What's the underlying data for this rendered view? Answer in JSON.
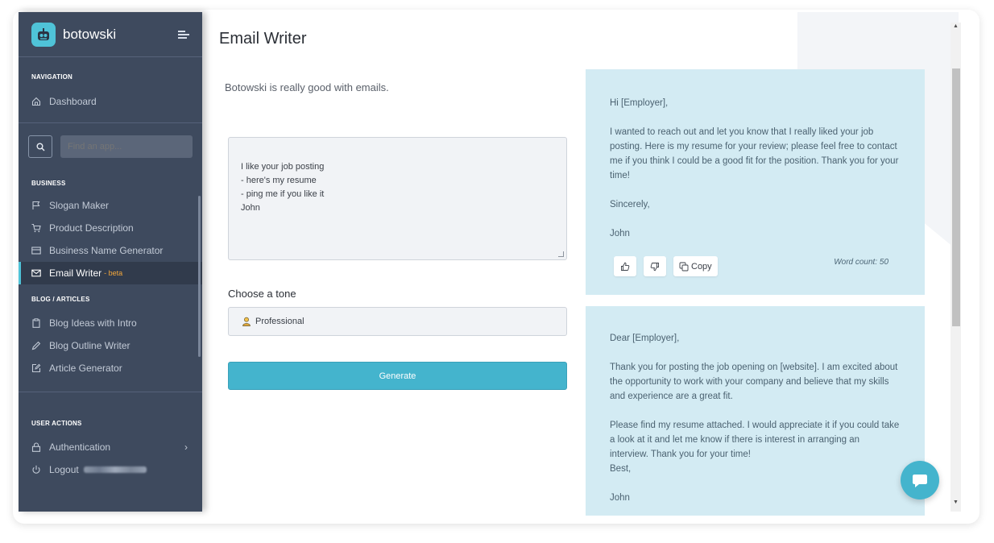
{
  "app": {
    "name": "botowski"
  },
  "sidebar": {
    "navigation_title": "NAVIGATION",
    "dashboard": "Dashboard",
    "search_placeholder": "Find an app...",
    "business_title": "BUSINESS",
    "business_items": [
      "Slogan Maker",
      "Product Description",
      "Business Name Generator",
      "Email Writer"
    ],
    "beta_tag": "- beta",
    "blog_title": "BLOG / ARTICLES",
    "blog_items": [
      "Blog Ideas with Intro",
      "Blog Outline Writer",
      "Article Generator"
    ],
    "user_title": "USER ACTIONS",
    "authentication": "Authentication",
    "logout": "Logout"
  },
  "main": {
    "title": "Email Writer",
    "subtitle": "Botowski is really good with emails.",
    "input_text": "I like your job posting\n- here's my resume\n- ping me if you like it\nJohn",
    "tone_label": "Choose a tone",
    "tone_value": "Professional",
    "generate_label": "Generate"
  },
  "results": [
    {
      "greeting": "Hi [Employer],",
      "body": "I wanted to reach out and let you know that I really liked your job posting. Here is my resume for your review; please feel free to contact me if you think I could be a good fit for the position. Thank you for your time!",
      "closing": "Sincerely,",
      "signature": "John",
      "copy_label": "Copy",
      "word_count": "Word count: 50"
    },
    {
      "greeting": "Dear [Employer],",
      "body": "Thank you for posting the job opening on [website]. I am excited about the opportunity to work with your company and believe that my skills and experience are a great fit.",
      "body2": "Please find my resume attached. I would appreciate it if you could take a look at it and let me know if there is interest in arranging an interview. Thank you for your time!",
      "closing": "Best,",
      "signature": "John"
    }
  ],
  "colors": {
    "accent": "#44b4cd",
    "sidebar": "#3e4a5e",
    "card": "#d3ebf3",
    "beta": "#f3a73b"
  },
  "icons": [
    "bot-logo-icon",
    "hamburger-icon",
    "home-icon",
    "search-icon",
    "flag-icon",
    "cart-icon",
    "card-icon",
    "mail-icon",
    "clipboard-icon",
    "pencil-icon",
    "edit-icon",
    "lock-icon",
    "power-icon",
    "thumbs-up-icon",
    "thumbs-down-icon",
    "copy-icon",
    "chat-icon"
  ]
}
